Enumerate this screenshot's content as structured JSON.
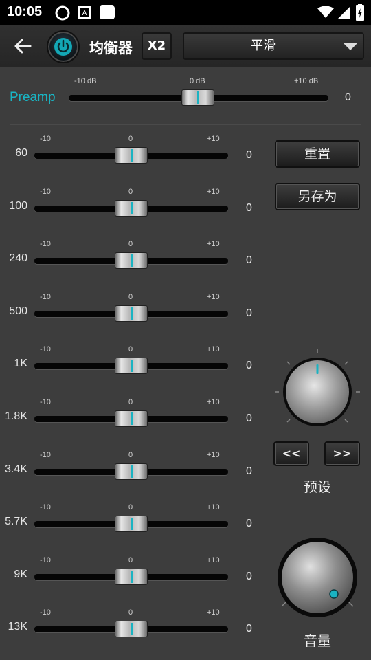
{
  "status_bar": {
    "time": "10:05",
    "icons": [
      "app-icon",
      "text-icon",
      "square-icon",
      "wifi-icon",
      "signal-icon",
      "battery-icon"
    ]
  },
  "header": {
    "title": "均衡器",
    "x2_label": "X2",
    "preset_value": "平滑"
  },
  "preamp": {
    "label": "Preamp",
    "min_label": "-10 dB",
    "mid_label": "0 dB",
    "max_label": "+10 dB",
    "value": "0"
  },
  "bands": [
    {
      "freq": "60",
      "min": "-10",
      "mid": "0",
      "max": "+10",
      "value": "0"
    },
    {
      "freq": "100",
      "min": "-10",
      "mid": "0",
      "max": "+10",
      "value": "0"
    },
    {
      "freq": "240",
      "min": "-10",
      "mid": "0",
      "max": "+10",
      "value": "0"
    },
    {
      "freq": "500",
      "min": "-10",
      "mid": "0",
      "max": "+10",
      "value": "0"
    },
    {
      "freq": "1K",
      "min": "-10",
      "mid": "0",
      "max": "+10",
      "value": "0"
    },
    {
      "freq": "1.8K",
      "min": "-10",
      "mid": "0",
      "max": "+10",
      "value": "0"
    },
    {
      "freq": "3.4K",
      "min": "-10",
      "mid": "0",
      "max": "+10",
      "value": "0"
    },
    {
      "freq": "5.7K",
      "min": "-10",
      "mid": "0",
      "max": "+10",
      "value": "0"
    },
    {
      "freq": "9K",
      "min": "-10",
      "mid": "0",
      "max": "+10",
      "value": "0"
    },
    {
      "freq": "13K",
      "min": "-10",
      "mid": "0",
      "max": "+10",
      "value": "0"
    }
  ],
  "actions": {
    "reset_label": "重置",
    "save_as_label": "另存为",
    "prev_label": "<<",
    "next_label": ">>",
    "preset_label": "预设",
    "volume_label": "音量"
  },
  "colors": {
    "accent": "#19b5c4",
    "background": "#3d3d3d",
    "track": "#050505"
  }
}
